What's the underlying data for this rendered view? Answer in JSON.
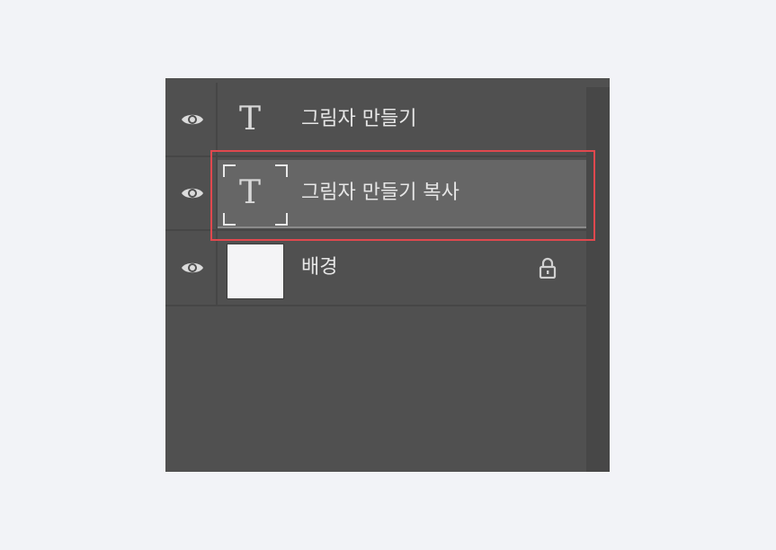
{
  "layers": [
    {
      "name": "그림자 만들기",
      "kind": "text",
      "thumb_glyph": "T",
      "visible": true,
      "selected": false,
      "locked": false
    },
    {
      "name": "그림자 만들기 복사",
      "kind": "text",
      "thumb_glyph": "T",
      "visible": true,
      "selected": true,
      "locked": false
    },
    {
      "name": "배경",
      "kind": "image",
      "visible": true,
      "selected": false,
      "locked": true
    }
  ],
  "icons": {
    "visibility": "eye-icon",
    "text_layer": "type-icon",
    "lock": "lock-icon"
  },
  "colors": {
    "panel_bg": "#505050",
    "selected_row": "#666666",
    "highlight_border": "#e0484e"
  }
}
